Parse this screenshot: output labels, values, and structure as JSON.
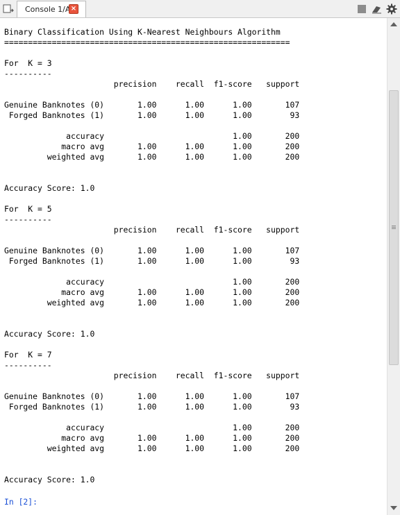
{
  "tab": {
    "label": "Console 1/A",
    "close_glyph": "×"
  },
  "toolbar_icons": [
    "options-icon",
    "stop-icon",
    "clear-console-icon",
    "gear-icon"
  ],
  "console": {
    "lines": [
      "Binary Classification Using K-Nearest Neighbours Algorithm",
      "============================================================",
      "",
      "For  K = 3",
      "----------",
      "                       precision    recall  f1-score   support",
      "",
      "Genuine Banknotes (0)       1.00      1.00      1.00       107",
      " Forged Banknotes (1)       1.00      1.00      1.00        93",
      "",
      "             accuracy                           1.00       200",
      "            macro avg       1.00      1.00      1.00       200",
      "         weighted avg       1.00      1.00      1.00       200",
      "",
      "",
      "Accuracy Score: 1.0",
      "",
      "For  K = 5",
      "----------",
      "                       precision    recall  f1-score   support",
      "",
      "Genuine Banknotes (0)       1.00      1.00      1.00       107",
      " Forged Banknotes (1)       1.00      1.00      1.00        93",
      "",
      "             accuracy                           1.00       200",
      "            macro avg       1.00      1.00      1.00       200",
      "         weighted avg       1.00      1.00      1.00       200",
      "",
      "",
      "Accuracy Score: 1.0",
      "",
      "For  K = 7",
      "----------",
      "                       precision    recall  f1-score   support",
      "",
      "Genuine Banknotes (0)       1.00      1.00      1.00       107",
      " Forged Banknotes (1)       1.00      1.00      1.00        93",
      "",
      "             accuracy                           1.00       200",
      "            macro avg       1.00      1.00      1.00       200",
      "         weighted avg       1.00      1.00      1.00       200",
      "",
      "",
      "Accuracy Score: 1.0",
      ""
    ],
    "prompt": "In [2]:"
  },
  "colors": {
    "prompt": "#1a4fd6",
    "tab_close": "#e9543c",
    "background": "#ffffff"
  }
}
